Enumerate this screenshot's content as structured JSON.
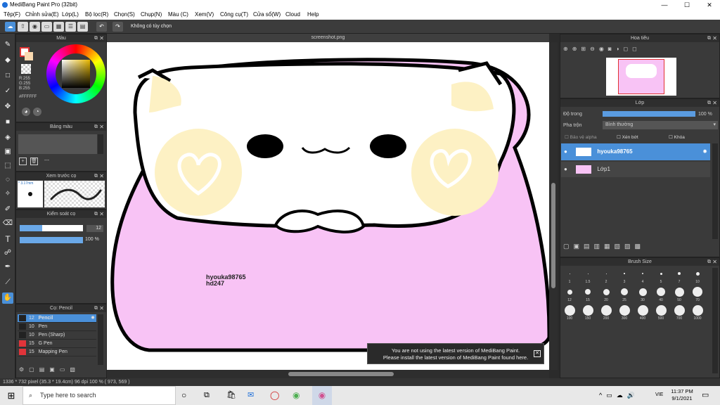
{
  "window": {
    "title": "MediBang Paint Pro (32bit)",
    "min": "—",
    "max": "☐",
    "close": "✕"
  },
  "menu": [
    "Tệp(F)",
    "Chỉnh sửa(E)",
    "Lớp(L)",
    "Bộ lọc(R)",
    "Chọn(S)",
    "Chụp(N)",
    "Màu (C)",
    "Xem(V)",
    "Công cụ(T)",
    "Cửa sổ(W)",
    "Cloud",
    "Help"
  ],
  "toolbar": {
    "selection_mode": "Không có tùy chọn"
  },
  "document": {
    "tab": "screenshot.png",
    "text_line1": "hyouka98765",
    "text_line2": "hd247"
  },
  "color_panel": {
    "title": "Màu",
    "r": "R:255",
    "g": "G:255",
    "b": "B:255",
    "hex": "#FFFFFF"
  },
  "palette_panel": {
    "title": "Bảng màu",
    "item": "---"
  },
  "brush_preview": {
    "title": "Xem trước cọ",
    "size": "* 3.17mm"
  },
  "brush_control": {
    "title": "Kiểm soát cọ",
    "size": "12",
    "opacity": "100 %",
    "size_level": 0.35,
    "opacity_level": 1.0
  },
  "brush_list": {
    "title": "Cọ: Pencil",
    "items": [
      {
        "size": "12",
        "name": "Pencil",
        "color": "#222222",
        "selected": true
      },
      {
        "size": "10",
        "name": "Pen",
        "color": "#222222",
        "selected": false
      },
      {
        "size": "10",
        "name": "Pen (Sharp)",
        "color": "#222222",
        "selected": false
      },
      {
        "size": "15",
        "name": "G Pen",
        "color": "#e0343a",
        "selected": false
      },
      {
        "size": "15",
        "name": "Mapping Pen",
        "color": "#e0343a",
        "selected": false
      }
    ]
  },
  "navigator": {
    "title": "Hoa tiêu"
  },
  "layers_panel": {
    "title": "Lớp",
    "opacity_label": "Độ trong",
    "opacity_value": "100 %",
    "blend_label": "Pha trộn",
    "blend_value": "Bình thường",
    "protect_alpha": "Bảo vệ alpha",
    "clipping": "Xén bớt",
    "lock": "Khóa",
    "layers": [
      {
        "name": "hyouka98765",
        "selected": true
      },
      {
        "name": "Lớp1",
        "selected": false
      }
    ]
  },
  "brush_size_panel": {
    "title": "Brush Size",
    "sizes": [
      "1",
      "1.5",
      "2",
      "3",
      "4",
      "5",
      "7",
      "10",
      "12",
      "15",
      "20",
      "25",
      "30",
      "40",
      "50",
      "70",
      "100",
      "150",
      "200",
      "300",
      "400",
      "500",
      "700",
      "1000"
    ]
  },
  "notice": {
    "line1": "You are not using the latest version of MediBang Paint.",
    "line2": "Please install the latest version of MediBang Paint found here."
  },
  "status": {
    "text": "1336 * 732 pixel   (35.3 * 19.4cm)   96 dpi   100 %   ( 973, 569 )"
  },
  "taskbar": {
    "search_placeholder": "Type here to search",
    "time": "11:37 PM",
    "date": "9/1/2021",
    "lang": "VIE"
  }
}
